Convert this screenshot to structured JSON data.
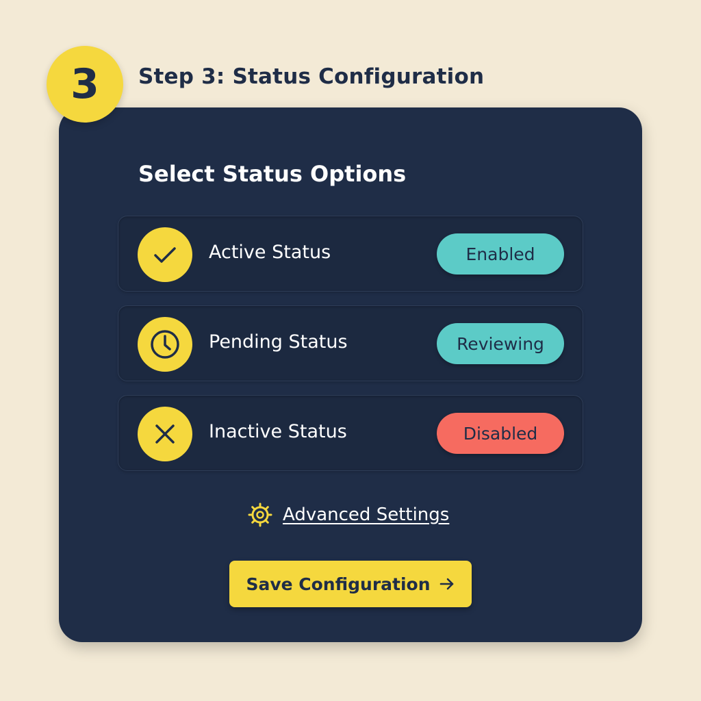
{
  "step": {
    "number": "3",
    "title": "Step 3: Status Configuration"
  },
  "card": {
    "title": "Select Status Options"
  },
  "options": [
    {
      "label": "Active Status",
      "status": "Enabled",
      "icon": "check-icon",
      "status_color": "#5ccbc7"
    },
    {
      "label": "Pending Status",
      "status": "Reviewing",
      "icon": "clock-icon",
      "status_color": "#5ccbc7"
    },
    {
      "label": "Inactive Status",
      "status": "Disabled",
      "icon": "x-icon",
      "status_color": "#f66b60"
    }
  ],
  "advanced": {
    "label": "Advanced Settings",
    "icon": "gear-icon"
  },
  "save_button": {
    "label": "Save Configuration",
    "icon": "arrow-right-icon"
  },
  "colors": {
    "background": "#f3ead6",
    "card": "#1f2d47",
    "accent": "#f5d83e",
    "teal": "#5ccbc7",
    "red": "#f66b60"
  }
}
